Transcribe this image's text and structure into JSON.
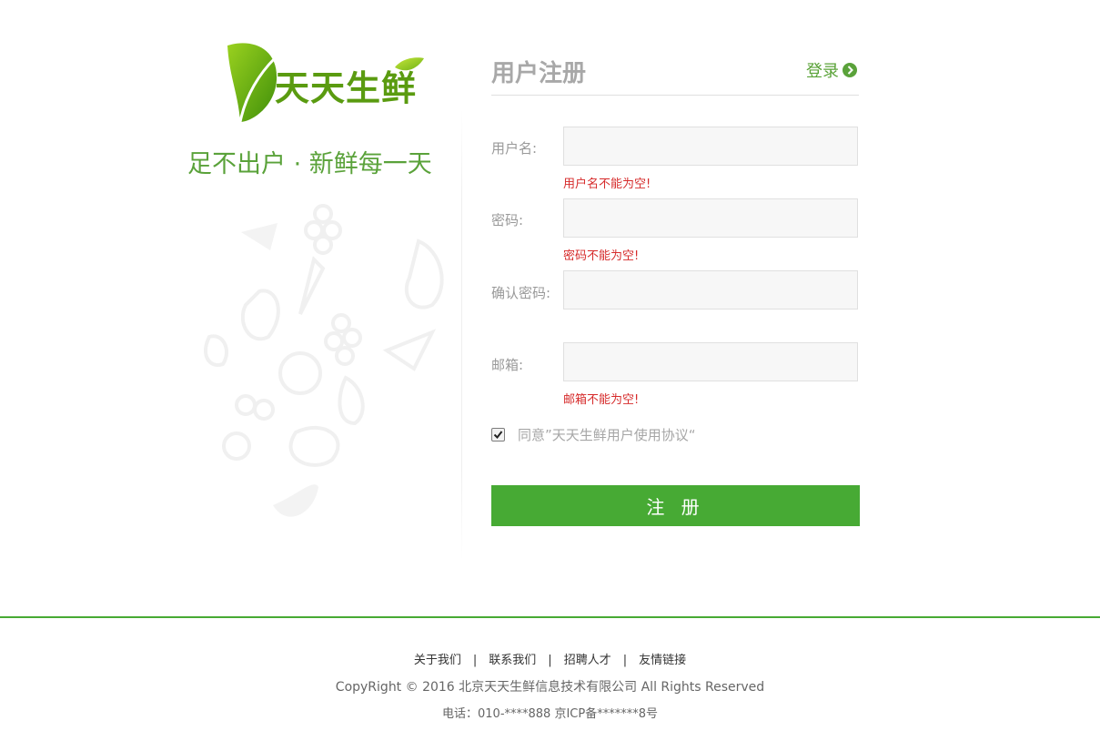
{
  "brand": {
    "logo_text": "天天生鲜",
    "slogan": "足不出户 · 新鲜每一天"
  },
  "form": {
    "title": "用户注册",
    "login_link": "登录",
    "fields": [
      {
        "label": "用户名:",
        "value": "",
        "error": "用户名不能为空!"
      },
      {
        "label": "密码:",
        "value": "",
        "error": "密码不能为空!"
      },
      {
        "label": "确认密码:",
        "value": "",
        "error": ""
      },
      {
        "label": "邮箱:",
        "value": "",
        "error": "邮箱不能为空!"
      }
    ],
    "agree_text": "同意”天天生鲜用户使用协议“",
    "agree_checked": true,
    "submit_label": "注 册"
  },
  "footer": {
    "links": [
      "关于我们",
      "联系我们",
      "招聘人才",
      "友情链接"
    ],
    "separator": "|",
    "copyright": "CopyRight © 2016 北京天天生鲜信息技术有限公司 All Rights Reserved",
    "phone": "电话：010-****888    京ICP备*******8号"
  },
  "colors": {
    "accent": "#47aa34",
    "error": "#d62b2b"
  }
}
